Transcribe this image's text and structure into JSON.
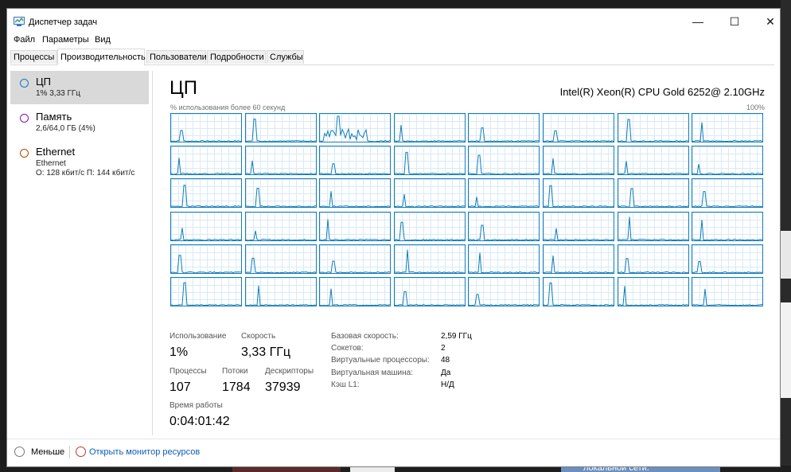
{
  "window": {
    "title": "Диспетчер задач",
    "controls": {
      "minimize": "—",
      "maximize": "☐",
      "close": "✕"
    }
  },
  "menu": [
    "Файл",
    "Параметры",
    "Вид"
  ],
  "tabs": [
    "Процессы",
    "Производительность",
    "Пользователи",
    "Подробности",
    "Службы"
  ],
  "active_tab": "Производительность",
  "sidebar": {
    "items": [
      {
        "title": "ЦП",
        "lines": [
          "1% 3,33 ГГц"
        ],
        "selected": true
      },
      {
        "title": "Память",
        "lines": [
          "2,6/64,0 ГБ (4%)"
        ],
        "ring_color": "#8b12ae"
      },
      {
        "title": "Ethernet",
        "lines": [
          "Ethernet",
          "О: 128 кбит/с П: 144 кбит/с"
        ],
        "ring_color": "#a74f01"
      }
    ],
    "cpu_ring_color": "#117dbb"
  },
  "cpu": {
    "title": "ЦП",
    "name": "Intel(R) Xeon(R) CPU Gold 6252@ 2.10GHz",
    "graph_label": "% использования более 60 секунд",
    "graph_max": "100%",
    "logical_processor_graphs": 48,
    "stats": {
      "usage_label": "Использование",
      "usage_value": "1%",
      "speed_label": "Скорость",
      "speed_value": "3,33 ГГц",
      "processes_label": "Процессы",
      "processes_value": "107",
      "threads_label": "Потоки",
      "threads_value": "1784",
      "handles_label": "Дескрипторы",
      "handles_value": "37939",
      "uptime_label": "Время работы",
      "uptime_value": "0:04:01:42"
    },
    "details": [
      {
        "key": "Базовая скорость:",
        "value": "2,59 ГГц"
      },
      {
        "key": "Сокетов:",
        "value": "2"
      },
      {
        "key": "Виртуальные процессоры:",
        "value": "48"
      },
      {
        "key": "Виртуальная машина:",
        "value": "Да"
      },
      {
        "key": "Кэш L1:",
        "value": "Н/Д"
      }
    ]
  },
  "footer": {
    "less_label": "Меньше",
    "monitor_link": "Открыть монитор ресурсов"
  },
  "background": {
    "snippet": "локальной сети."
  },
  "colors": {
    "graph_line": "#117dbb",
    "graph_grid": "#d9eaf7",
    "link": "#0a5fb4"
  }
}
